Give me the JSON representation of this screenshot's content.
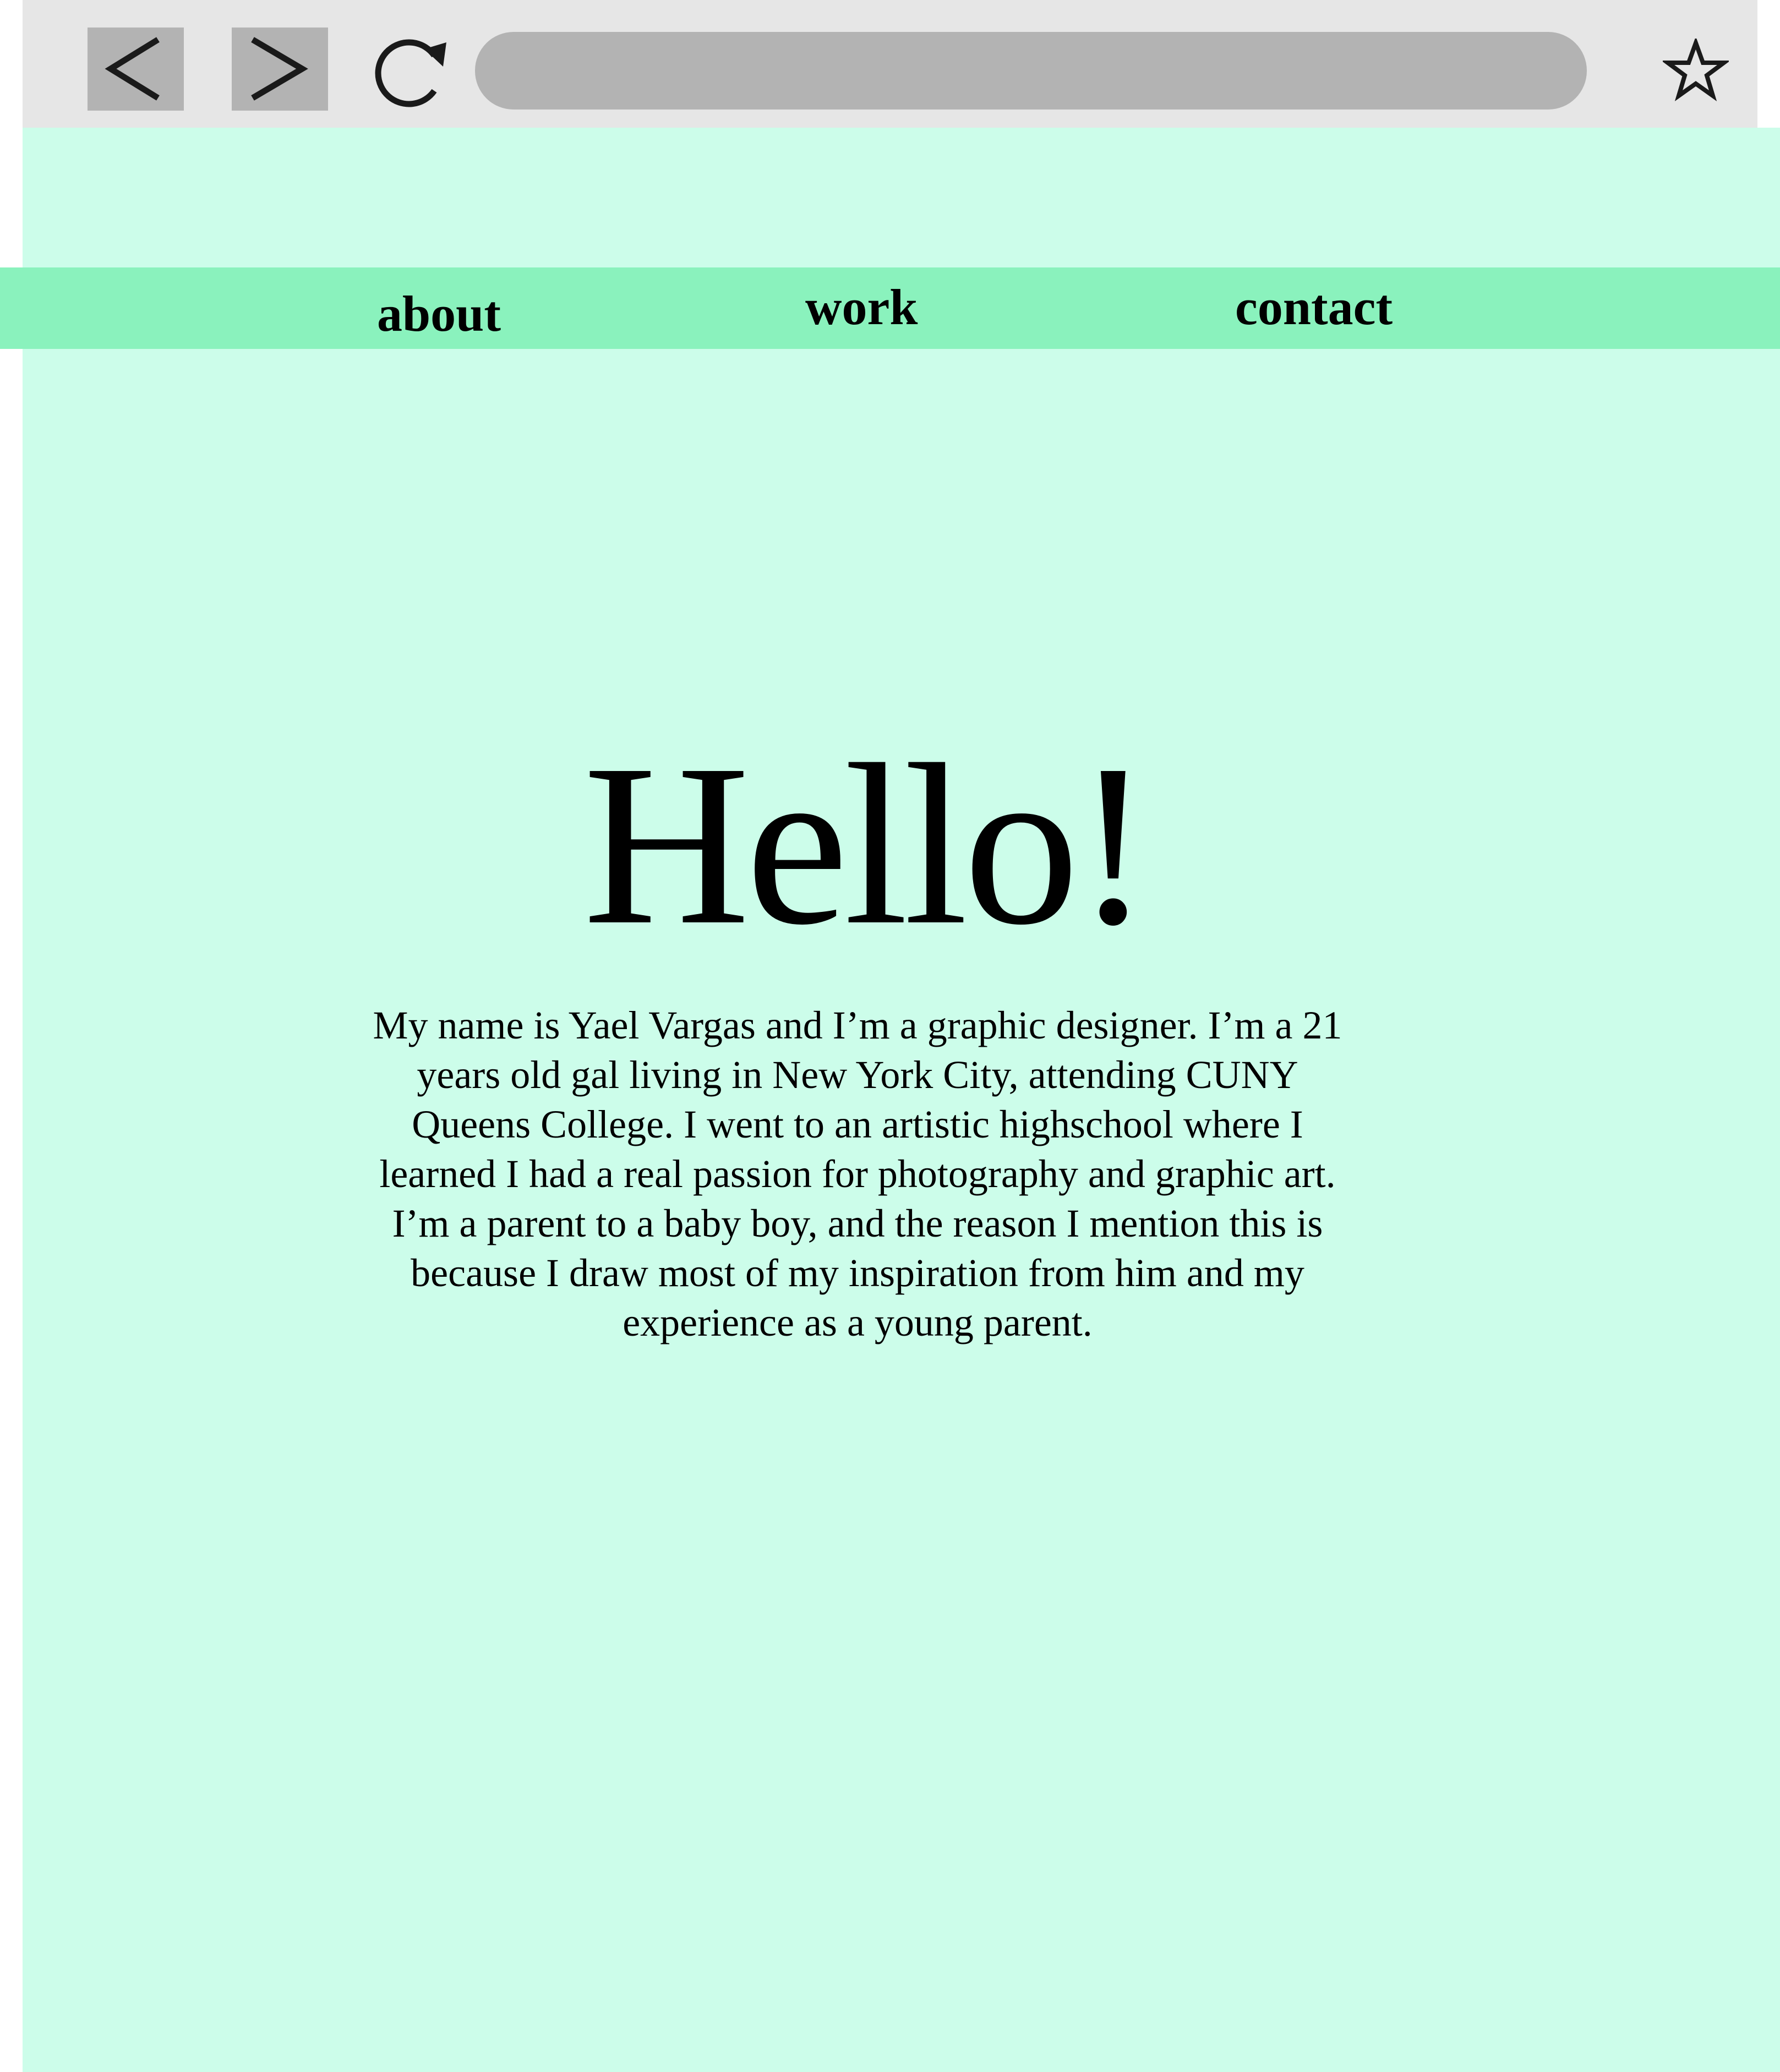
{
  "browser": {
    "back_icon": "chevron-left-icon",
    "forward_icon": "chevron-right-icon",
    "reload_icon": "reload-icon",
    "bookmark_icon": "star-icon",
    "address_value": ""
  },
  "colors": {
    "browser_bar": "#e6e6e6",
    "button_bg": "#b3b3b3",
    "page_bg": "#ccfdea",
    "nav_bg": "#8af2bd",
    "text": "#000000"
  },
  "nav": {
    "items": [
      {
        "label": "about"
      },
      {
        "label": "work"
      },
      {
        "label": "contact"
      }
    ]
  },
  "hero": {
    "heading": "Hello!",
    "bio": "My name is Yael Vargas and I’m a graphic designer. I’m a 21 years old gal living in New York City, attending CUNY Queens College. I went to an artistic highschool where I learned I had a real passion for photography and graphic art. I’m a parent to a baby boy, and the reason I mention this is because I draw most of my inspiration from him and my experience as a young parent."
  }
}
